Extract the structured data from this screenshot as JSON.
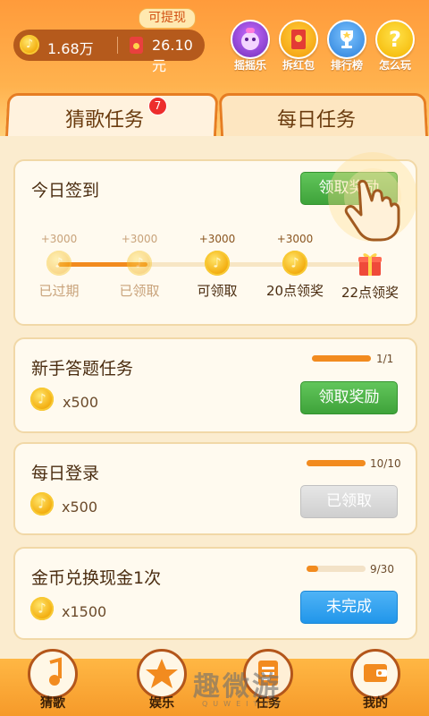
{
  "header": {
    "coins_value": "1.68万",
    "cash_value": "26.10元",
    "withdraw_label": "可提现",
    "actions": [
      {
        "label": "摇摇乐",
        "icon": "shake-icon",
        "color": "#8a4bd6"
      },
      {
        "label": "拆红包",
        "icon": "red-envelope-icon",
        "color": "#e33b35"
      },
      {
        "label": "排行榜",
        "icon": "trophy-icon",
        "color": "#3a8ee6"
      },
      {
        "label": "怎么玩",
        "icon": "question-icon",
        "color": "#f6b400"
      }
    ]
  },
  "tabs": [
    {
      "label": "猜歌任务",
      "badge": "7"
    },
    {
      "label": "每日任务"
    }
  ],
  "checkin": {
    "title": "今日签到",
    "button_label": "领取奖励",
    "steps": [
      {
        "amount": "+3000",
        "label": "已过期",
        "icon": "coin-icon"
      },
      {
        "amount": "+3000",
        "label": "已领取",
        "icon": "coin-icon"
      },
      {
        "amount": "+3000",
        "label": "可领取",
        "icon": "coin-icon"
      },
      {
        "amount": "+3000",
        "label": "20点领奖",
        "icon": "coin-icon"
      },
      {
        "amount": "",
        "label": "22点领奖",
        "icon": "gift-icon"
      }
    ]
  },
  "tasks": [
    {
      "title": "新手答题任务",
      "reward": "x500",
      "progress_text": "1/1",
      "progress": 1.0,
      "button_label": "领取奖励",
      "button_style": "green"
    },
    {
      "title": "每日登录",
      "reward": "x500",
      "progress_text": "10/10",
      "progress": 1.0,
      "button_label": "已领取",
      "button_style": "gray"
    },
    {
      "title": "金币兑换现金1次",
      "reward": "x1500",
      "progress_text": "9/30",
      "progress": 0.3,
      "button_label": "未完成",
      "button_style": "blue"
    }
  ],
  "bottom_nav": [
    {
      "label": "猜歌",
      "icon": "music-note-icon"
    },
    {
      "label": "娱乐",
      "icon": "star-icon"
    },
    {
      "label": "任务",
      "icon": "task-list-icon"
    },
    {
      "label": "我的",
      "icon": "wallet-icon"
    }
  ],
  "watermark": {
    "text": "趣微游",
    "sub": "QUWEIYOU"
  }
}
